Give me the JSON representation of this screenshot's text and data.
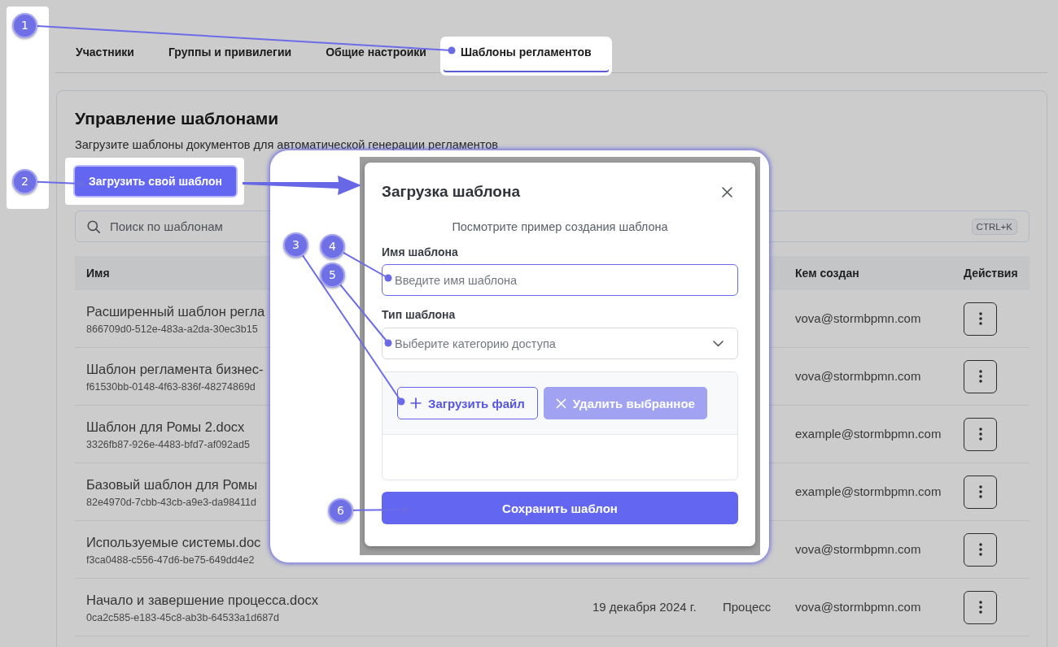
{
  "callouts": [
    {
      "number": "1"
    },
    {
      "number": "2"
    },
    {
      "number": "3"
    },
    {
      "number": "4"
    },
    {
      "number": "5"
    },
    {
      "number": "6"
    }
  ],
  "tabs": [
    {
      "label": "Участники",
      "selected": false
    },
    {
      "label": "Группы и привилегии",
      "selected": false
    },
    {
      "label": "Общие настройки",
      "selected": false
    },
    {
      "label": "Шаблоны регламентов",
      "selected": true
    }
  ],
  "panel": {
    "title": "Управление шаблонами",
    "description": "Загрузите шаблоны документов для автоматической генерации регламентов",
    "upload_button": {
      "label": "Загрузить свой шаблон",
      "highlighted": true
    },
    "search": {
      "placeholder": "Поиск по шаблонам",
      "shortcut": "CTRL+K"
    }
  },
  "table": {
    "columns": {
      "name": "Имя",
      "created_by": "Кем создан",
      "actions": "Действия"
    },
    "rows": [
      {
        "name": "Расширенный шаблон регла",
        "id": "866709d0-512e-483a-a2da-30ec3b15",
        "created_by": "vova@stormbpmn.com"
      },
      {
        "name": "Шаблон регламента бизнес-",
        "id": "f61530bb-0148-4f63-836f-48274869d",
        "created_by": "vova@stormbpmn.com"
      },
      {
        "name": "Шаблон для Ромы 2.docx",
        "id": "3326fb87-926e-4483-bfd7-af092ad5",
        "created_by": "example@stormbpmn.com"
      },
      {
        "name": "Базовый шаблон для Ромы",
        "id": "82e4970d-7cbb-43cb-a9e3-da98411d",
        "created_by": "example@stormbpmn.com"
      },
      {
        "name": "Используемые системы.doc",
        "id": "f3ca0488-c556-47d6-be75-649dd4e2",
        "created_by": "vova@stormbpmn.com"
      },
      {
        "name": "Начало и завершение процесса.docx",
        "id": "0ca2c585-e183-45c8-ab3b-64533a1d687d",
        "date": "19 декабря 2024 г.",
        "type": "Процесс",
        "created_by": "vova@stormbpmn.com"
      }
    ]
  },
  "dialog": {
    "title": "Загрузка шаблона",
    "hint": "Посмотрите пример создания шаблона",
    "fields": [
      {
        "kind": "text",
        "label": "Имя шаблона",
        "placeholder": "Введите имя шаблона",
        "focused": true
      },
      {
        "kind": "select",
        "label": "Тип шаблона",
        "placeholder": "Выберите категорию доступа",
        "focused": false
      }
    ],
    "file_area": {
      "buttons": [
        {
          "kind": "upload",
          "label": "Загрузить файл",
          "disabled": false
        },
        {
          "kind": "remove",
          "label": "Удалить выбранное",
          "disabled": true
        }
      ]
    },
    "submit_button": {
      "label": "Сохранить шаблон"
    }
  }
}
